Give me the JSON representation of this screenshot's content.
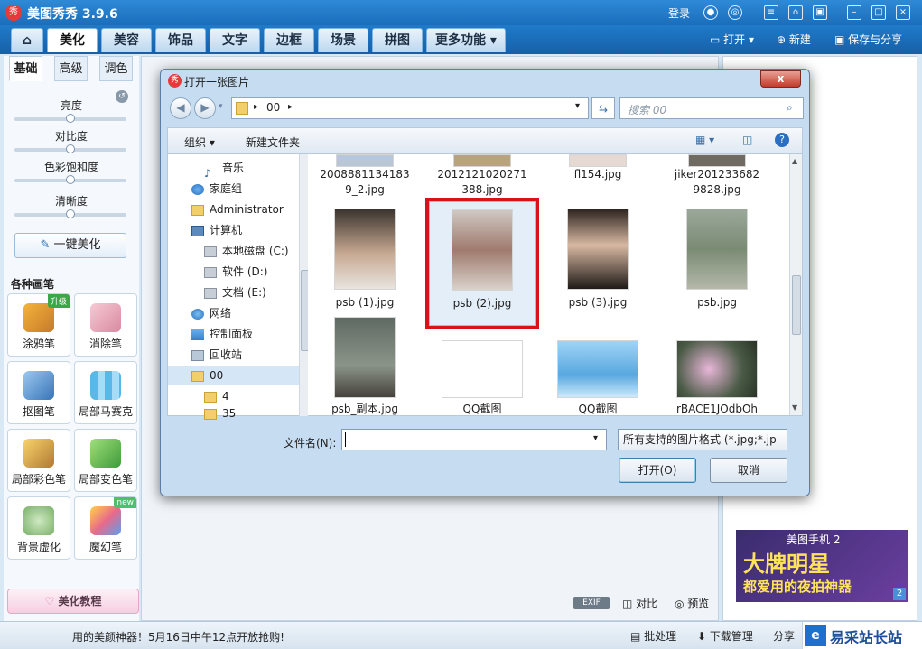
{
  "app": {
    "title": "美图秀秀 3.9.6",
    "logo_text": "秀",
    "login": "登录"
  },
  "nav": {
    "tabs": [
      {
        "label": "美化",
        "active": true
      },
      {
        "label": "美容"
      },
      {
        "label": "饰品"
      },
      {
        "label": "文字"
      },
      {
        "label": "边框"
      },
      {
        "label": "场景"
      },
      {
        "label": "拼图"
      },
      {
        "label": "更多功能 ▾"
      }
    ],
    "open": "打开",
    "new": "新建",
    "save_share": "保存与分享"
  },
  "left_panel": {
    "tabs": [
      "基础",
      "高级",
      "调色"
    ],
    "sliders": [
      {
        "label": "亮度",
        "value": 0.5
      },
      {
        "label": "对比度",
        "value": 0.5
      },
      {
        "label": "色彩饱和度",
        "value": 0.5
      },
      {
        "label": "清晰度",
        "value": 0.5
      }
    ],
    "one_click": "一键美化",
    "brush_title": "各种画笔",
    "brushes": [
      {
        "label": "涂鸦笔",
        "icon": "brush-icon",
        "badge": "升级"
      },
      {
        "label": "消除笔",
        "icon": "eraser-icon"
      },
      {
        "label": "抠图笔",
        "icon": "cutout-pen-icon"
      },
      {
        "label": "局部马赛克",
        "icon": "mosaic-icon"
      },
      {
        "label": "局部彩色笔",
        "icon": "color-brush-icon"
      },
      {
        "label": "局部变色笔",
        "icon": "color-change-icon"
      },
      {
        "label": "背景虚化",
        "icon": "blur-icon"
      },
      {
        "label": "魔幻笔",
        "icon": "magic-pen-icon",
        "badge": "new"
      }
    ],
    "tutorial": "美化教程"
  },
  "canvas_footer": {
    "exif": "EXIF",
    "compare": "对比",
    "preview": "预览"
  },
  "ad": {
    "line1": "美图手机 2",
    "line2": "大牌明星",
    "line3": "都爱用的夜拍神器",
    "page": "2"
  },
  "statusbar": {
    "marquee": "用的美颜神器！5月16日中午12点开放抢购!",
    "batch": "批处理",
    "download": "下载管理",
    "share": "分享",
    "watermark": "易采站长站"
  },
  "dialog": {
    "title": "打开一张图片",
    "close": "x",
    "path": "00",
    "search_placeholder": "搜索 00",
    "organize": "组织 ▾",
    "new_folder": "新建文件夹",
    "tree": [
      {
        "label": "音乐",
        "icon": "music-icon",
        "indent": 1
      },
      {
        "label": "家庭组",
        "icon": "homegroup-icon",
        "indent": 0
      },
      {
        "label": "Administrator",
        "icon": "user-folder-icon",
        "indent": 0
      },
      {
        "label": "计算机",
        "icon": "computer-icon",
        "indent": 0
      },
      {
        "label": "本地磁盘 (C:)",
        "icon": "drive-icon",
        "indent": 1
      },
      {
        "label": "软件 (D:)",
        "icon": "drive-icon",
        "indent": 1
      },
      {
        "label": "文档 (E:)",
        "icon": "drive-icon",
        "indent": 1
      },
      {
        "label": "网络",
        "icon": "network-icon",
        "indent": 0
      },
      {
        "label": "控制面板",
        "icon": "control-panel-icon",
        "indent": 0
      },
      {
        "label": "回收站",
        "icon": "recycle-bin-icon",
        "indent": 0
      },
      {
        "label": "00",
        "icon": "folder-icon",
        "indent": 0,
        "selected": true
      },
      {
        "label": "4",
        "icon": "folder-icon",
        "indent": 1
      },
      {
        "label": "35",
        "icon": "folder-icon",
        "indent": 1
      }
    ],
    "files_row0": [
      {
        "name": "2008881134183\n9_2.jpg"
      },
      {
        "name": "2012121020271\n388.jpg"
      },
      {
        "name": "fl154.jpg"
      },
      {
        "name": "jiker201233682\n9828.jpg"
      }
    ],
    "files_row1": [
      {
        "name": "psb (1).jpg"
      },
      {
        "name": "psb (2).jpg",
        "highlighted": true
      },
      {
        "name": "psb (3).jpg"
      },
      {
        "name": "psb.jpg"
      }
    ],
    "files_row2": [
      {
        "name": "psb_副本.jpg"
      },
      {
        "name": "QQ截图"
      },
      {
        "name": "QQ截图"
      },
      {
        "name": "rBACE1JOdbOh"
      }
    ],
    "filename_label": "文件名(N):",
    "filename_value": "",
    "filter": "所有支持的图片格式 (*.jpg;*.jp",
    "open_button": "打开(O)",
    "cancel_button": "取消"
  }
}
